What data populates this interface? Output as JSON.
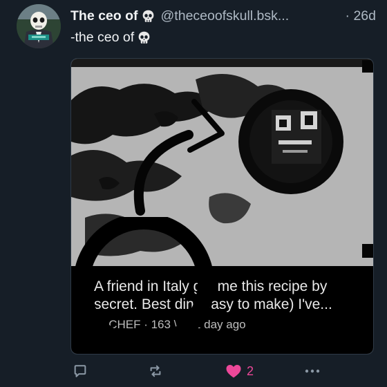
{
  "post": {
    "display_name": "The ceo of",
    "handle": "@theceoofskull.bsk...",
    "time": "· 26d",
    "text": "-the ceo of",
    "name_emoji": "skull-emoji",
    "text_emoji": "skull-emoji"
  },
  "embed": {
    "caption_line1": "A friend in Italy      ght me this recipe by",
    "caption_line2": "secret. Best din      (easy to make) I've...",
    "meta": "'G CHEF · 163 \\      ; · 1 day ago"
  },
  "actions": {
    "reply_icon": "reply-icon",
    "repost_icon": "repost-icon",
    "like_icon": "heart-icon",
    "like_count": "2",
    "more_icon": "more-icon"
  },
  "colors": {
    "background": "#161e27",
    "text": "#f1f3f5",
    "muted": "#aeb9c4",
    "like": "#ec4899"
  }
}
